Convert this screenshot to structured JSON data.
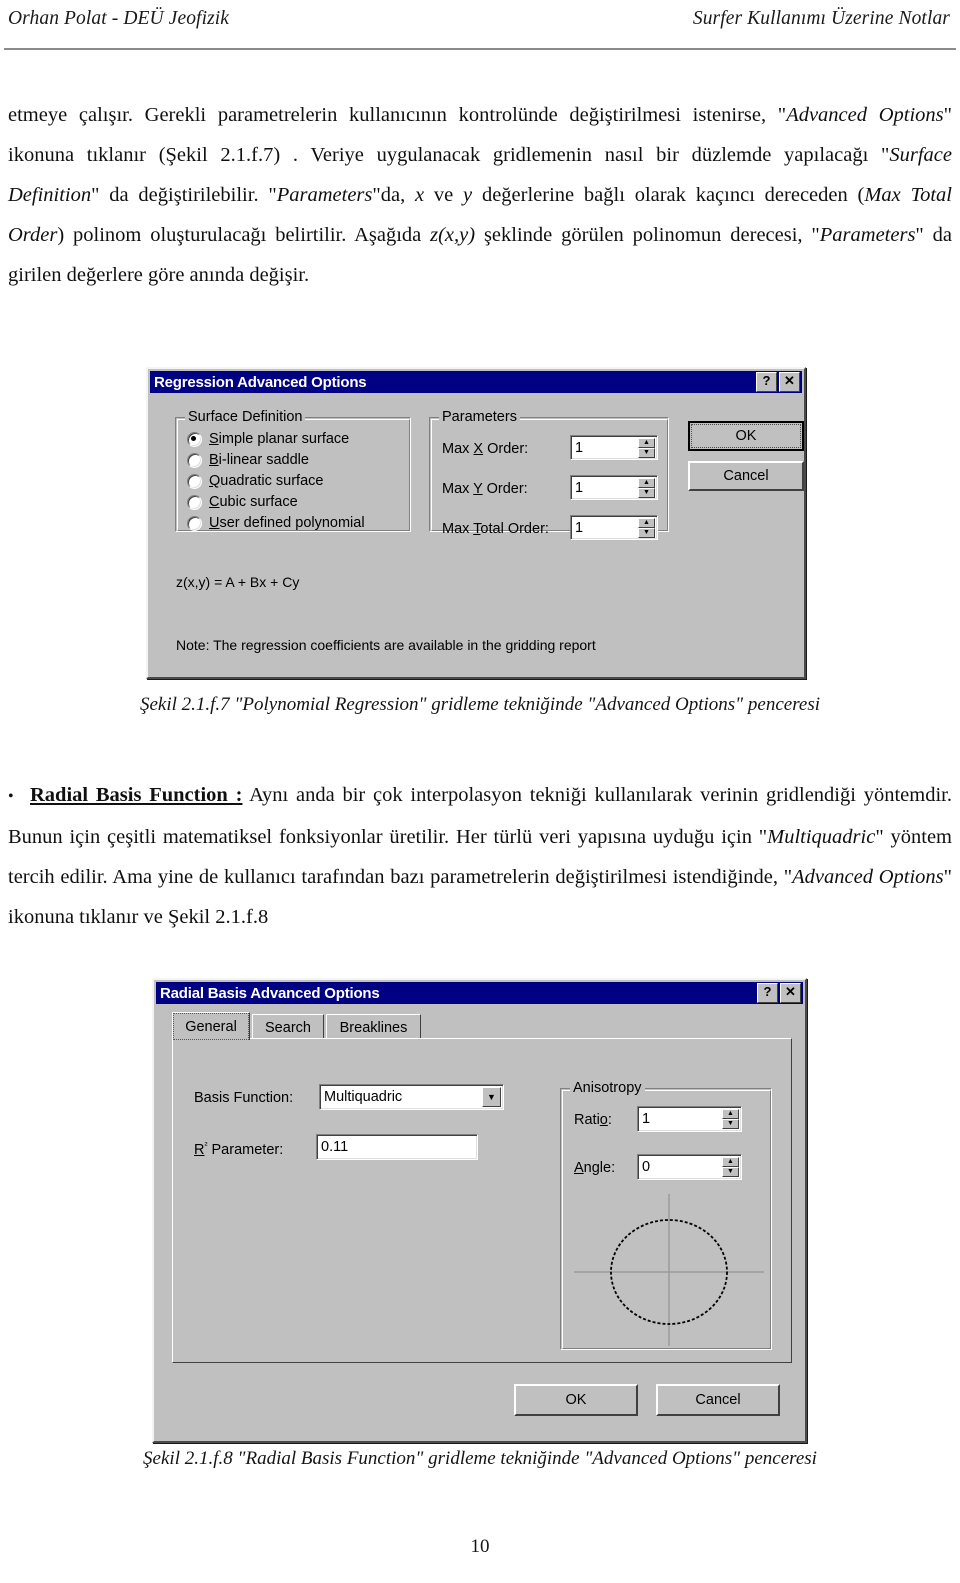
{
  "header": {
    "left": "Orhan Polat - DEÜ Jeofizik",
    "right": "Surfer Kullanımı Üzerine Notlar"
  },
  "paragraph1": {
    "seg1": "etmeye çalışır. Gerekli parametrelerin kullanıcının kontrolünde değiştirilmesi istenirse, \"",
    "em1": "Advanced Options",
    "seg2": "\" ikonuna tıklanır (Şekil 2.1.f.7) . Veriye uygulanacak gridlemenin nasıl bir düzlemde yapılacağı \"",
    "em2": "Surface Definition",
    "seg3": "\" da değiştirilebilir. \"",
    "em3": "Parameters",
    "seg4": "\"da, ",
    "em4": "x",
    "seg5": " ve ",
    "em5": "y",
    "seg6": " değerlerine bağlı olarak kaçıncı dereceden (",
    "em6": "Max Total Order",
    "seg7": ") polinom oluşturulacağı belirtilir. Aşağıda ",
    "em7": "z(x,y)",
    "seg8": " şeklinde görülen polinomun derecesi, \"",
    "em8": "Parameters",
    "seg9": "\" da girilen değerlere göre anında değişir."
  },
  "paragraph2": {
    "bullet": "•",
    "heading": "Radial Basis Function :",
    "seg1": " Aynı anda bir çok interpolasyon tekniği kullanılarak verinin gridlendiği yöntemdir. Bunun için çeşitli matematiksel fonksiyonlar üretilir. Her türlü veri yapısına uyduğu için \"",
    "em1": "Multiquadric",
    "seg2": "\" yöntem tercih edilir. Ama yine de kullanıcı tarafından bazı parametrelerin değiştirilmesi istendiğinde, \"",
    "em2": "Advanced Options",
    "seg3": "\" ikonuna tıklanır ve Şekil 2.1.f.8"
  },
  "dialog1": {
    "title": "Regression Advanced Options",
    "help_btn": "?",
    "close_btn": "✕",
    "surface_group_label": "Surface Definition",
    "radios": [
      {
        "label_pre": "S",
        "label_post": "imple planar surface",
        "selected": true
      },
      {
        "label_pre": "B",
        "label_post": "i-linear saddle",
        "selected": false
      },
      {
        "label_pre": "Q",
        "label_post": "uadratic surface",
        "selected": false
      },
      {
        "label_pre": "C",
        "label_post": "ubic surface",
        "selected": false
      },
      {
        "label_pre": "U",
        "label_post": "ser defined polynomial",
        "selected": false
      }
    ],
    "parameters_group_label": "Parameters",
    "params": [
      {
        "label_pre": "Max ",
        "label_key": "X",
        "label_post": " Order:",
        "value": "1"
      },
      {
        "label_pre": "Max ",
        "label_key": "Y",
        "label_post": " Order:",
        "value": "1"
      },
      {
        "label_pre": "Max ",
        "label_key": "T",
        "label_post": "otal Order:",
        "value": "1"
      }
    ],
    "formula": "z(x,y) = A + Bx + Cy",
    "note": "Note: The regression coefficients are available in the gridding report",
    "ok_label": "OK",
    "cancel_label": "Cancel",
    "spin_up": "▲",
    "spin_down": "▼"
  },
  "caption1": "Şekil 2.1.f.7 \"Polynomial Regression\" gridleme tekniğinde \"Advanced Options\" penceresi",
  "dialog2": {
    "title": "Radial Basis Advanced Options",
    "help_btn": "?",
    "close_btn": "✕",
    "tabs": [
      {
        "label": "General",
        "active": true
      },
      {
        "label": "Search",
        "active": false
      },
      {
        "label": "Breaklines",
        "active": false
      }
    ],
    "basis_function_label": "Basis Function:",
    "basis_function_value": "Multiquadric",
    "combo_arrow": "▼",
    "r2_label_pre": "R",
    "r2_label_sup": "²",
    "r2_label_post": " Parameter:",
    "r2_value": "0.11",
    "anisotropy_group_label": "Anisotropy",
    "ratio_label_pre": "Rati",
    "ratio_label_key": "o",
    "ratio_label_post": ":",
    "ratio_value": "1",
    "angle_label_key": "A",
    "angle_label_post": "ngle:",
    "angle_value": "0",
    "ok_label": "OK",
    "cancel_label": "Cancel",
    "spin_up": "▲",
    "spin_down": "▼"
  },
  "caption2": "Şekil 2.1.f.8 \"Radial Basis Function\" gridleme tekniğinde \"Advanced Options\" penceresi",
  "page_number": "10",
  "colors": {
    "titlebar": "#000082",
    "dialog_face": "#c0c0c0",
    "field_bg": "#ffffff"
  }
}
